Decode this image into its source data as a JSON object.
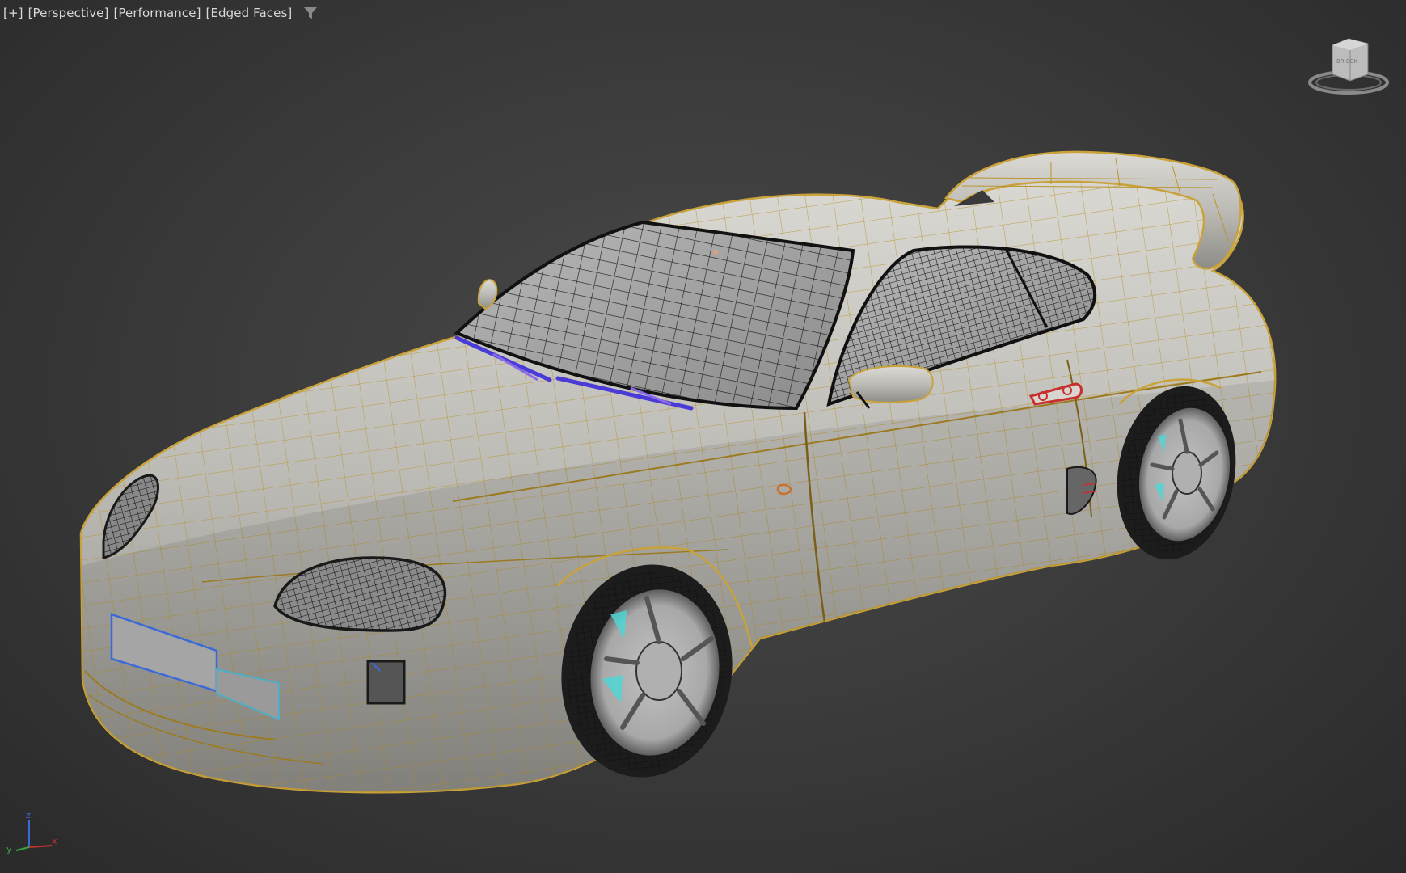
{
  "viewport": {
    "labels": {
      "menu": "[+]",
      "view": "[Perspective]",
      "shading": "[Performance]",
      "edges": "[Edged Faces]"
    },
    "icons": {
      "filter": "filter-icon",
      "viewcube": "viewcube-icon",
      "axis": "axis-tripod-icon"
    },
    "viewcube_text": "BR  BCK",
    "axis_labels": {
      "z": "z",
      "x": "x",
      "y": "y"
    }
  },
  "colors": {
    "background": "#3c3c3c",
    "wire_gold": "#c9a23a",
    "wire_dark": "#1a1a1a",
    "body": "#c8c6c0",
    "selection_blue": "#3a6ad8",
    "wiper_purple": "#6a4ae0",
    "accent_red": "#c83030",
    "accent_cyan": "#4ad8d8"
  }
}
